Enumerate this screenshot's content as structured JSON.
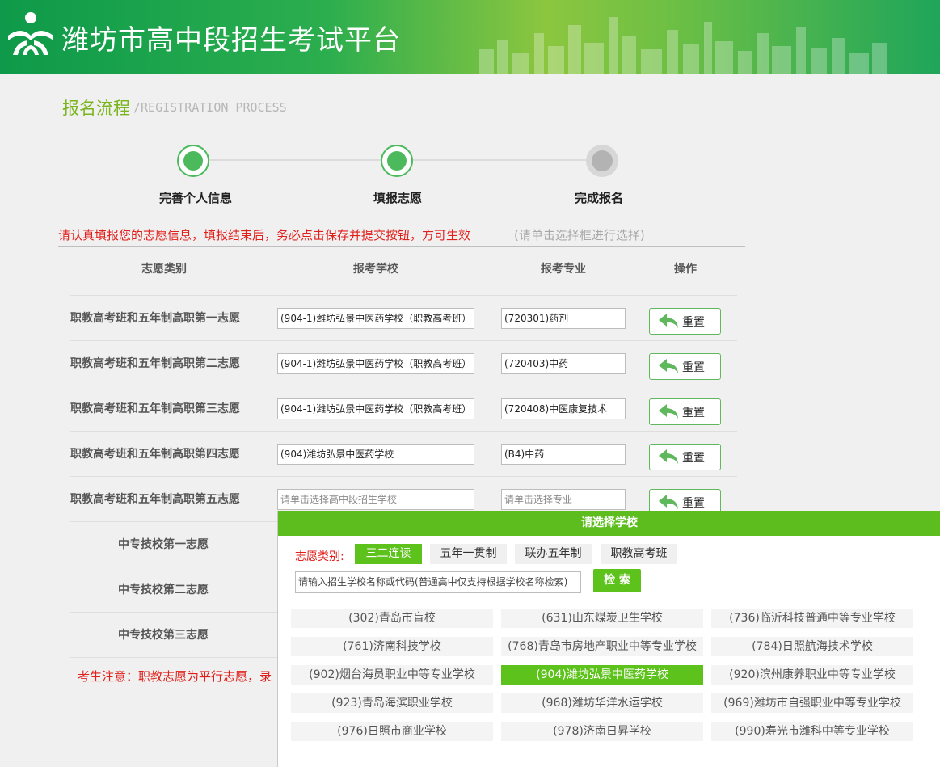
{
  "header": {
    "title": "潍坊市高中段招生考试平台"
  },
  "section": {
    "title": "报名流程",
    "subtitle": "/REGISTRATION PROCESS"
  },
  "steps": [
    {
      "label": "完善个人信息",
      "state": "done"
    },
    {
      "label": "填报志愿",
      "state": "done"
    },
    {
      "label": "完成报名",
      "state": "todo"
    }
  ],
  "notice": {
    "text": "请认真填报您的志愿信息，填报结束后，务必点击保存并提交按钮，方可生效",
    "hint": "(请单击选择框进行选择)"
  },
  "table": {
    "headers": [
      "志愿类别",
      "报考学校",
      "报考专业",
      "操作"
    ],
    "reset_label": "重置",
    "rows": [
      {
        "category": "职教高考班和五年制高职第一志愿",
        "school": "(904-1)潍坊弘景中医药学校（职教高考班）",
        "major": "(720301)药剂"
      },
      {
        "category": "职教高考班和五年制高职第二志愿",
        "school": "(904-1)潍坊弘景中医药学校（职教高考班）",
        "major": "(720403)中药"
      },
      {
        "category": "职教高考班和五年制高职第三志愿",
        "school": "(904-1)潍坊弘景中医药学校（职教高考班）",
        "major": "(720408)中医康复技术"
      },
      {
        "category": "职教高考班和五年制高职第四志愿",
        "school": "(904)潍坊弘景中医药学校",
        "major": "(B4)中药"
      },
      {
        "category": "职教高考班和五年制高职第五志愿",
        "school": "",
        "major": "",
        "school_placeholder": "请单击选择高中段招生学校",
        "major_placeholder": "请单击选择专业"
      },
      {
        "category": "中专技校第一志愿"
      },
      {
        "category": "中专技校第二志愿"
      },
      {
        "category": "中专技校第三志愿"
      }
    ]
  },
  "bottom_note": "考生注意：职教志愿为平行志愿，录",
  "popup": {
    "title": "请选择学校",
    "category_label": "志愿类别:",
    "categories": [
      {
        "label": "三二连读",
        "active": true
      },
      {
        "label": "五年一贯制",
        "active": false
      },
      {
        "label": "联办五年制",
        "active": false
      },
      {
        "label": "职教高考班",
        "active": false
      }
    ],
    "search_placeholder": "请输入招生学校名称或代码(普通高中仅支持根据学校名称检索)",
    "search_button": "检 索",
    "schools": [
      "(302)青岛市盲校",
      "(631)山东煤炭卫生学校",
      "(736)临沂科技普通中等专业学校",
      "(761)济南科技学校",
      "(768)青岛市房地产职业中等专业学校",
      "(784)日照航海技术学校",
      "(902)烟台海员职业中等专业学校",
      "(904)潍坊弘景中医药学校",
      "(920)滨州康养职业中等专业学校",
      "(923)青岛海滨职业学校",
      "(968)潍坊华洋水运学校",
      "(969)潍坊市自强职业中等专业学校",
      "(976)日照市商业学校",
      "(978)济南日昇学校",
      "(990)寿光市潍科中等专业学校"
    ],
    "selected_school": "(904)潍坊弘景中医药学校"
  },
  "colors": {
    "brand_green": "#5ec21c",
    "warning_red": "#e1201b",
    "step_green": "#4cba5c"
  }
}
